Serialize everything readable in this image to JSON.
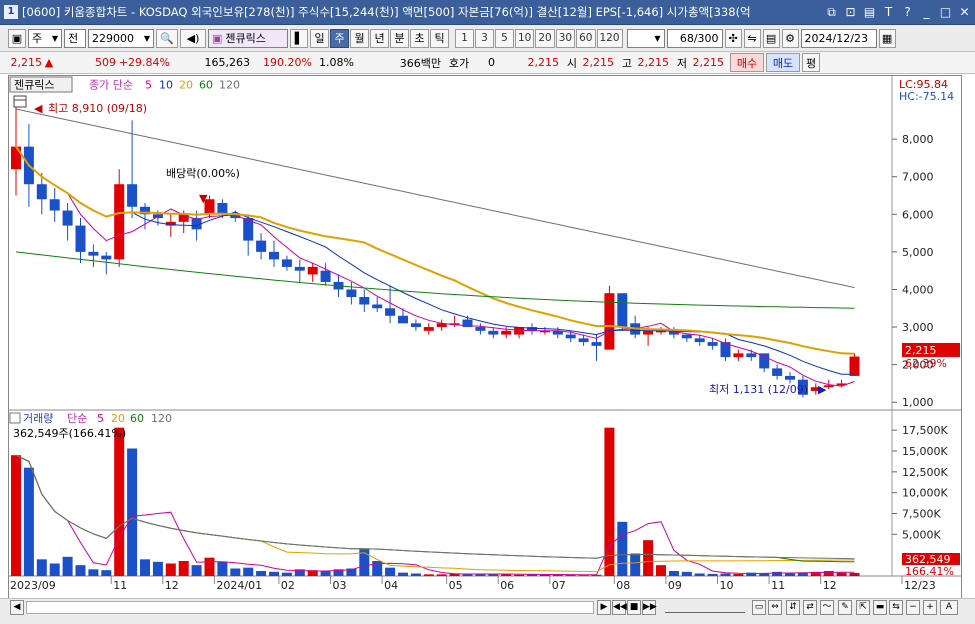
{
  "window": {
    "number": "1",
    "title": "[0600] 키움종합차트 - KOSDAQ 외국인보유[278(천)] 주식수[15,244(천)] 액면[500] 자본금[76(억)] 결산[12월] EPS[-1,646] 시가총액[338(억"
  },
  "toolbar": {
    "period": "주",
    "view": "전",
    "code": "229000",
    "name": "젠큐릭스",
    "periods": [
      "일",
      "주",
      "월",
      "년",
      "분",
      "초",
      "틱"
    ],
    "selected_period": "주",
    "intervals": [
      "1",
      "3",
      "5",
      "10",
      "20",
      "30",
      "60",
      "120"
    ],
    "count": "68/300",
    "date": "2024/12/23"
  },
  "quote": {
    "price": "2,215",
    "arrow": "▲",
    "change": "509",
    "change_pct": "+29.84%",
    "volume": "165,263",
    "vol_ratio": "190.20%",
    "turnover": "1.08%",
    "amount": "366백만",
    "hoga_label": "호가",
    "hoga_val": "0",
    "hoga_price": "2,215",
    "open_label": "시",
    "open": "2,215",
    "high_label": "고",
    "high": "2,215",
    "low_label": "저",
    "low": "2,215",
    "buy": "매수",
    "sell": "매도",
    "pyeong": "평"
  },
  "price_panel": {
    "name": "젠큐릭스",
    "legend_title": "종가 단순",
    "ma": [
      "5",
      "10",
      "20",
      "60",
      "120"
    ],
    "lc": "LC:95.84",
    "hc": "HC:-75.14",
    "max_label": "최고 8,910 (09/18)",
    "min_label": "최저 1,131 (12/09)",
    "div_label": "배당락(0.00%)",
    "y_ticks": [
      "8,000",
      "7,000",
      "6,000",
      "5,000",
      "4,000",
      "3,000",
      "2,000",
      "1,000"
    ],
    "cur_price": "2,215",
    "cur_pct": "62.39%"
  },
  "volume_panel": {
    "title": "거래량",
    "legend": "단순",
    "ma": [
      "5",
      "20",
      "60",
      "120"
    ],
    "cur_label": "362,549주(166.41%)",
    "y_ticks": [
      "17,500K",
      "15,000K",
      "12,500K",
      "10,000K",
      "7,500K",
      "5,000K"
    ],
    "cur_vol": "362,549",
    "cur_pct": "166.41%"
  },
  "x_axis": [
    "2023/09",
    "11",
    "12",
    "2024/01",
    "02",
    "03",
    "04",
    "05",
    "06",
    "07",
    "08",
    "09",
    "10",
    "11",
    "12",
    "12/23"
  ],
  "colors": {
    "up": "#e00000",
    "down": "#1a50c8",
    "ma5": "#d000a0",
    "ma10": "#1030c0",
    "ma20": "#e0a000",
    "ma60": "#108010",
    "ma120": "#707070"
  },
  "chart_data": {
    "type": "candlestick",
    "candles": [
      [
        7200,
        8910,
        6500,
        7800
      ],
      [
        7800,
        8400,
        6200,
        6800
      ],
      [
        6800,
        7100,
        6000,
        6400
      ],
      [
        6400,
        6700,
        5800,
        6100
      ],
      [
        6100,
        6300,
        5300,
        5700
      ],
      [
        5700,
        5900,
        4700,
        5000
      ],
      [
        5000,
        5200,
        4600,
        4900
      ],
      [
        4900,
        5000,
        4400,
        4800
      ],
      [
        4800,
        7200,
        4600,
        6800
      ],
      [
        6800,
        8500,
        5900,
        6200
      ],
      [
        6200,
        6300,
        5600,
        6000
      ],
      [
        6000,
        6100,
        5700,
        5900
      ],
      [
        5700,
        6000,
        5400,
        5800
      ],
      [
        5800,
        6100,
        5500,
        6000
      ],
      [
        5900,
        6100,
        5300,
        5600
      ],
      [
        6000,
        6500,
        5900,
        6400
      ],
      [
        6300,
        6400,
        5900,
        6000
      ],
      [
        6000,
        6100,
        5800,
        5900
      ],
      [
        5900,
        6000,
        4900,
        5300
      ],
      [
        5300,
        5500,
        4800,
        5000
      ],
      [
        5000,
        5300,
        4600,
        4800
      ],
      [
        4800,
        4900,
        4500,
        4600
      ],
      [
        4600,
        4800,
        4200,
        4500
      ],
      [
        4400,
        4700,
        4200,
        4600
      ],
      [
        4500,
        4700,
        4100,
        4200
      ],
      [
        4200,
        4400,
        3800,
        4000
      ],
      [
        4000,
        4200,
        3600,
        3800
      ],
      [
        3800,
        4000,
        3400,
        3600
      ],
      [
        3600,
        3800,
        3400,
        3500
      ],
      [
        3500,
        4100,
        3100,
        3300
      ],
      [
        3300,
        3500,
        3100,
        3100
      ],
      [
        3100,
        3200,
        2900,
        3000
      ],
      [
        2900,
        3100,
        2800,
        3000
      ],
      [
        3000,
        3200,
        2900,
        3100
      ],
      [
        3100,
        3300,
        3000,
        3100
      ],
      [
        3200,
        3300,
        3000,
        3000
      ],
      [
        3000,
        3100,
        2800,
        2900
      ],
      [
        2900,
        3000,
        2700,
        2800
      ],
      [
        2800,
        3000,
        2700,
        2900
      ],
      [
        2800,
        3000,
        2700,
        3000
      ],
      [
        3000,
        3100,
        2800,
        2900
      ],
      [
        2900,
        3000,
        2800,
        2900
      ],
      [
        2900,
        3000,
        2700,
        2800
      ],
      [
        2800,
        2900,
        2600,
        2700
      ],
      [
        2700,
        2800,
        2500,
        2600
      ],
      [
        2600,
        2800,
        2100,
        2500
      ],
      [
        2400,
        4100,
        2400,
        3900
      ],
      [
        3900,
        3900,
        2900,
        3000
      ],
      [
        3100,
        3300,
        2700,
        2800
      ],
      [
        2800,
        3000,
        2500,
        2900
      ],
      [
        2900,
        3000,
        2800,
        2900
      ],
      [
        2900,
        3000,
        2700,
        2800
      ],
      [
        2800,
        2800,
        2600,
        2700
      ],
      [
        2700,
        2800,
        2500,
        2600
      ],
      [
        2600,
        2700,
        2400,
        2500
      ],
      [
        2600,
        2700,
        2100,
        2200
      ],
      [
        2200,
        2400,
        2100,
        2300
      ],
      [
        2300,
        2400,
        2100,
        2200
      ],
      [
        2300,
        2300,
        1800,
        1900
      ],
      [
        1900,
        2000,
        1600,
        1700
      ],
      [
        1700,
        1800,
        1500,
        1600
      ],
      [
        1600,
        1700,
        1131,
        1200
      ],
      [
        1300,
        1500,
        1200,
        1400
      ],
      [
        1400,
        1600,
        1350,
        1450
      ],
      [
        1450,
        1600,
        1400,
        1500
      ],
      [
        1700,
        2300,
        1700,
        2215
      ]
    ],
    "volume_k": [
      14500,
      13000,
      2000,
      1500,
      2300,
      1300,
      800,
      700,
      17800,
      15300,
      2000,
      1700,
      1500,
      1800,
      1300,
      2200,
      1700,
      900,
      1000,
      600,
      500,
      400,
      800,
      700,
      600,
      800,
      900,
      3200,
      1800,
      1000,
      400,
      300,
      200,
      200,
      300,
      200,
      300,
      200,
      200,
      150,
      200,
      150,
      200,
      150,
      100,
      150,
      17800,
      6500,
      2700,
      4300,
      1300,
      600,
      500,
      300,
      250,
      300,
      250,
      400,
      350,
      500,
      300,
      400,
      500,
      600,
      400,
      362
    ],
    "ylim": [
      900,
      9200
    ],
    "vol_ylim": [
      0,
      18000
    ]
  }
}
